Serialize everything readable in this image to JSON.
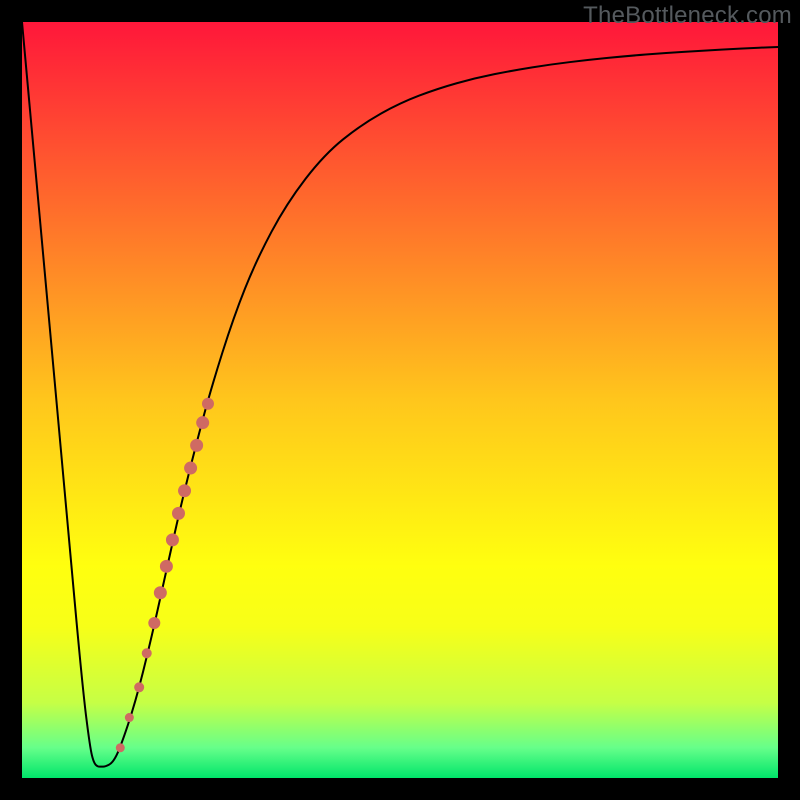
{
  "watermark": "TheBottleneck.com",
  "chart_data": {
    "type": "line",
    "title": "",
    "xlabel": "",
    "ylabel": "",
    "xlim": [
      0,
      100
    ],
    "ylim": [
      0,
      100
    ],
    "grid": false,
    "background_gradient": {
      "stops": [
        {
          "offset": 0.0,
          "color": "#ff173a"
        },
        {
          "offset": 0.25,
          "color": "#ff6e2b"
        },
        {
          "offset": 0.5,
          "color": "#ffc61c"
        },
        {
          "offset": 0.72,
          "color": "#ffff0f"
        },
        {
          "offset": 0.8,
          "color": "#f7ff18"
        },
        {
          "offset": 0.9,
          "color": "#c6ff45"
        },
        {
          "offset": 0.96,
          "color": "#66ff8a"
        },
        {
          "offset": 1.0,
          "color": "#00e56a"
        }
      ]
    },
    "series": [
      {
        "name": "bottleneck-curve",
        "x": [
          0.0,
          2.0,
          4.0,
          6.0,
          8.0,
          9.0,
          9.5,
          10.0,
          10.5,
          11.0,
          12.0,
          13.0,
          15.0,
          17.0,
          19.0,
          21.0,
          23.0,
          25.0,
          28.0,
          31.0,
          35.0,
          40.0,
          45.0,
          50.0,
          55.0,
          60.0,
          65.0,
          70.0,
          75.0,
          80.0,
          85.0,
          90.0,
          95.0,
          100.0
        ],
        "y": [
          100.0,
          78.0,
          56.0,
          34.0,
          12.0,
          4.0,
          2.0,
          1.5,
          1.5,
          1.5,
          2.0,
          4.0,
          10.0,
          18.0,
          27.0,
          36.0,
          44.0,
          51.5,
          61.0,
          68.5,
          76.0,
          82.5,
          86.5,
          89.3,
          91.2,
          92.6,
          93.6,
          94.4,
          95.0,
          95.5,
          95.9,
          96.2,
          96.5,
          96.7
        ]
      }
    ],
    "markers": {
      "name": "highlight-segment",
      "color": "#cf6a63",
      "points": [
        {
          "x": 13.0,
          "y": 4.0,
          "r": 4.5
        },
        {
          "x": 14.2,
          "y": 8.0,
          "r": 4.5
        },
        {
          "x": 15.5,
          "y": 12.0,
          "r": 5.0
        },
        {
          "x": 16.5,
          "y": 16.5,
          "r": 5.0
        },
        {
          "x": 17.5,
          "y": 20.5,
          "r": 6.0
        },
        {
          "x": 18.3,
          "y": 24.5,
          "r": 6.5
        },
        {
          "x": 19.1,
          "y": 28.0,
          "r": 6.5
        },
        {
          "x": 19.9,
          "y": 31.5,
          "r": 6.5
        },
        {
          "x": 20.7,
          "y": 35.0,
          "r": 6.5
        },
        {
          "x": 21.5,
          "y": 38.0,
          "r": 6.5
        },
        {
          "x": 22.3,
          "y": 41.0,
          "r": 6.5
        },
        {
          "x": 23.1,
          "y": 44.0,
          "r": 6.5
        },
        {
          "x": 23.9,
          "y": 47.0,
          "r": 6.5
        },
        {
          "x": 24.6,
          "y": 49.5,
          "r": 6.0
        }
      ]
    }
  }
}
